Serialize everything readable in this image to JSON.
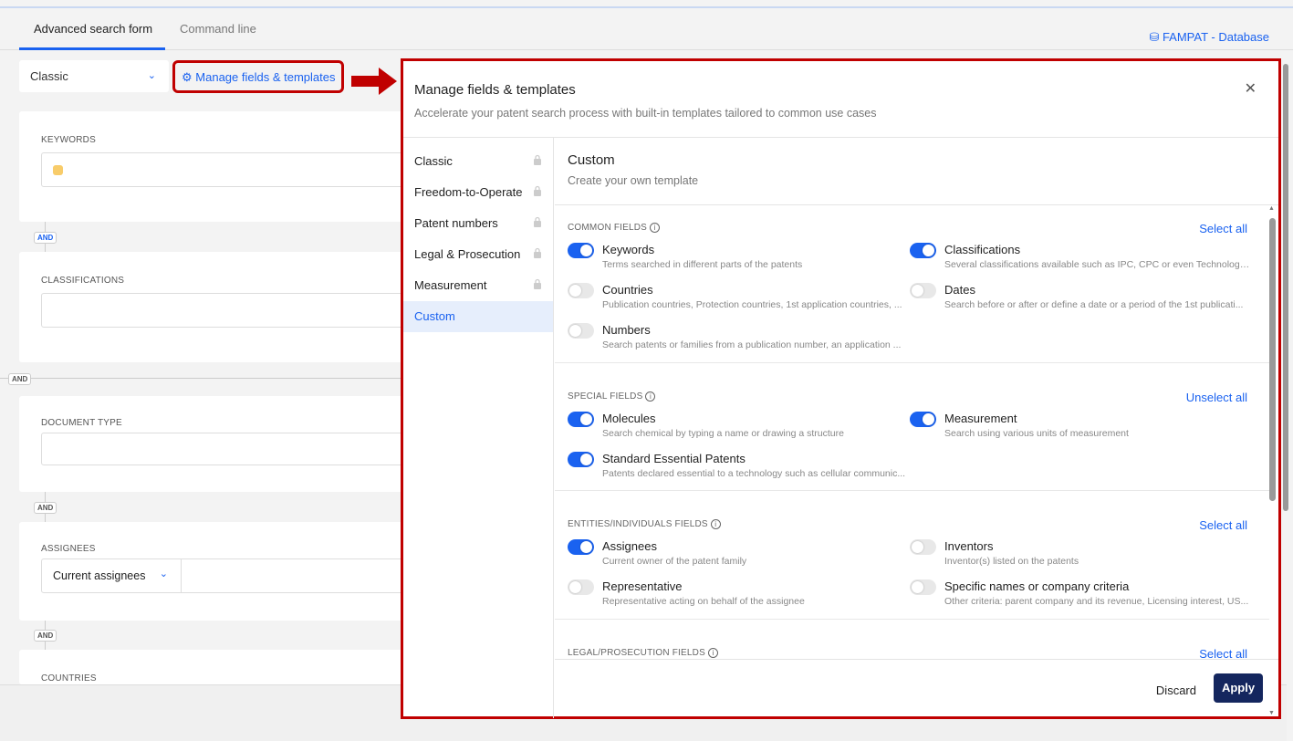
{
  "tabs": [
    {
      "label": "Advanced search form"
    },
    {
      "label": "Command line"
    }
  ],
  "database": "FAMPAT - Database",
  "template_select": "Classic",
  "manage_link": "Manage fields & templates",
  "form": {
    "keywords_label": "KEYWORDS",
    "classifications_label": "CLASSIFICATIONS",
    "document_type_label": "DOCUMENT TYPE",
    "assignees_label": "ASSIGNEES",
    "assignees_select": "Current assignees",
    "countries_label": "COUNTRIES",
    "and": "AND"
  },
  "modal": {
    "title": "Manage fields & templates",
    "subtitle": "Accelerate your patent search process with built-in templates tailored to common use cases",
    "nav": [
      {
        "label": "Classic",
        "locked": true
      },
      {
        "label": "Freedom-to-Operate",
        "locked": true
      },
      {
        "label": "Patent numbers",
        "locked": true
      },
      {
        "label": "Legal & Prosecution",
        "locked": true
      },
      {
        "label": "Measurement",
        "locked": true
      },
      {
        "label": "Custom",
        "locked": false,
        "active": true
      }
    ],
    "panel_title": "Custom",
    "panel_subtitle": "Create your own template",
    "sections": [
      {
        "title": "COMMON FIELDS",
        "action": "Select all",
        "fields": [
          {
            "name": "Keywords",
            "desc": "Terms searched in different parts of the patents",
            "on": true
          },
          {
            "name": "Classifications",
            "desc": "Several classifications available such as IPC, CPC or even Technology ...",
            "on": true
          },
          {
            "name": "Countries",
            "desc": "Publication countries, Protection countries, 1st application countries, ...",
            "on": false
          },
          {
            "name": "Dates",
            "desc": "Search before or after or define a date or a period of the 1st publicati...",
            "on": false
          },
          {
            "name": "Numbers",
            "desc": "Search patents or families from a publication number, an application ...",
            "on": false
          }
        ]
      },
      {
        "title": "SPECIAL FIELDS",
        "action": "Unselect all",
        "fields": [
          {
            "name": "Molecules",
            "desc": "Search chemical by typing a name or drawing a structure",
            "on": true
          },
          {
            "name": "Measurement",
            "desc": "Search using various units of measurement",
            "on": true
          },
          {
            "name": "Standard Essential Patents",
            "desc": "Patents declared essential to a technology such as cellular communic...",
            "on": true
          }
        ]
      },
      {
        "title": "ENTITIES/INDIVIDUALS FIELDS",
        "action": "Select all",
        "fields": [
          {
            "name": "Assignees",
            "desc": "Current owner of the patent family",
            "on": true
          },
          {
            "name": "Inventors",
            "desc": "Inventor(s) listed on the patents",
            "on": false
          },
          {
            "name": "Representative",
            "desc": "Representative acting on behalf of the assignee",
            "on": false
          },
          {
            "name": "Specific names or company criteria",
            "desc": "Other criteria: parent company and its revenue, Licensing interest, US...",
            "on": false
          }
        ]
      },
      {
        "title": "LEGAL/PROSECUTION FIELDS",
        "action": "Select all",
        "fields": []
      }
    ],
    "discard": "Discard",
    "apply": "Apply"
  },
  "colors": {
    "accent": "#1a62f0",
    "highlight": "#c00000",
    "apply": "#14265e"
  }
}
